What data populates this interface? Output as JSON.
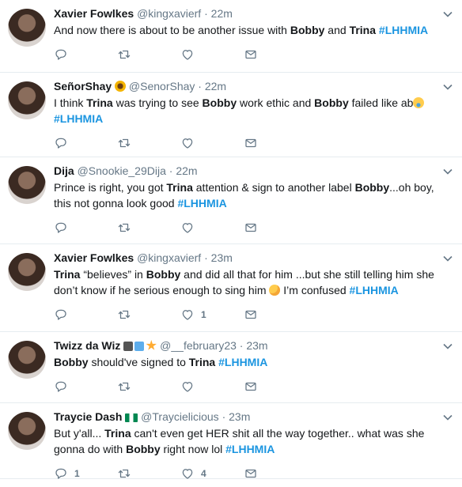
{
  "tweets": [
    {
      "name": "Xavier Fowlkes",
      "handle": "@kingxavierf",
      "dot": "·",
      "time": "22m",
      "body": [
        {
          "t": "And now there is about to be another issue with "
        },
        {
          "t": "Bobby",
          "b": true
        },
        {
          "t": " and "
        },
        {
          "t": "Trina",
          "b": true
        },
        {
          "t": " "
        },
        {
          "t": "#LHHMIA",
          "tag": true
        }
      ],
      "reply_count": "",
      "like_count": ""
    },
    {
      "name": "SeñorShay",
      "name_emoji": "sunflower-emoji",
      "handle": "@SenorShay",
      "dot": "·",
      "time": "22m",
      "body": [
        {
          "t": "I think "
        },
        {
          "t": "Trina",
          "b": true
        },
        {
          "t": " was trying to see "
        },
        {
          "t": "Bobby",
          "b": true
        },
        {
          "t": " work ethic and "
        },
        {
          "t": "Bobby",
          "b": true
        },
        {
          "t": " failed like ab"
        },
        {
          "emoji": "crying-face-emoji"
        },
        {
          "t": " "
        },
        {
          "t": "#LHHMIA",
          "tag": true
        }
      ],
      "reply_count": "",
      "like_count": ""
    },
    {
      "name": "Dija",
      "handle": "@Snookie_29Dija",
      "dot": "·",
      "time": "22m",
      "body": [
        {
          "t": "Prince is right, you got "
        },
        {
          "t": "Trina",
          "b": true
        },
        {
          "t": " attention & sign to another label "
        },
        {
          "t": "Bobby",
          "b": true
        },
        {
          "t": "...oh boy, this not gonna look good "
        },
        {
          "t": "#LHHMIA",
          "tag": true
        }
      ],
      "reply_count": "",
      "like_count": ""
    },
    {
      "name": "Xavier Fowlkes",
      "handle": "@kingxavierf",
      "dot": "·",
      "time": "23m",
      "body": [
        {
          "t": "Trina",
          "b": true
        },
        {
          "t": " “believes” in "
        },
        {
          "t": "Bobby",
          "b": true
        },
        {
          "t": " and did all that for him ...but she still telling him she don’t know if he serious enough to sing him "
        },
        {
          "emoji": "thinking-face-emoji"
        },
        {
          "t": " I’m confused  "
        },
        {
          "t": "#LHHMIA",
          "tag": true
        }
      ],
      "reply_count": "",
      "like_count": "1"
    },
    {
      "name": "Twizz da Wiz",
      "name_emoji": "microphone-music-star-emoji",
      "handle": "@__february23",
      "dot": "·",
      "time": "23m",
      "body": [
        {
          "t": "Bobby",
          "b": true
        },
        {
          "t": " should've signed to "
        },
        {
          "t": "Trina",
          "b": true
        },
        {
          "t": " "
        },
        {
          "t": "#LHHMIA",
          "tag": true
        }
      ],
      "reply_count": "",
      "like_count": ""
    },
    {
      "name": "Traycie Dash",
      "name_emoji": "nigeria-flag-emoji",
      "handle": "@Traycielicious",
      "dot": "·",
      "time": "23m",
      "body": [
        {
          "t": "But y'all... "
        },
        {
          "t": "Trina",
          "b": true
        },
        {
          "t": " can't even get HER shit all the way together.. what was she gonna do with "
        },
        {
          "t": "Bobby",
          "b": true
        },
        {
          "t": " right now lol  "
        },
        {
          "t": "#LHHMIA",
          "tag": true
        }
      ],
      "reply_count": "1",
      "like_count": "4"
    }
  ],
  "colors": {
    "hashtag": "#1b95e0",
    "icon": "#657786",
    "divider": "#e6ecf0"
  }
}
